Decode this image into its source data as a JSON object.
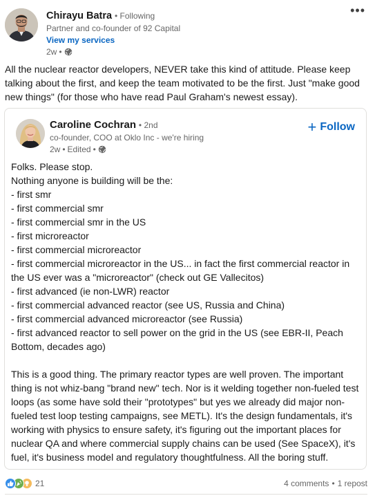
{
  "post": {
    "menu_icon": "ellipsis-icon",
    "author": {
      "name": "Chirayu Batra",
      "follow_status": "Following",
      "headline": "Partner and co-founder of 92 Capital",
      "services_link": "View my services",
      "time": "2w",
      "visibility_icon": "globe-icon"
    },
    "commentary": "All the nuclear reactor developers, NEVER take this kind of attitude. Please keep talking about the first, and keep the team motivated to be the first. Just \"make good new things\" (for those who have read Paul Graham's newest essay).",
    "shared": {
      "author": {
        "name": "Caroline Cochran",
        "degree": "2nd",
        "headline": "co-founder, COO at Oklo Inc - we're hiring",
        "time": "2w",
        "edited": "Edited",
        "visibility_icon": "globe-icon"
      },
      "follow_label": "Follow",
      "lines": [
        "Folks. Please stop.",
        "Nothing anyone is building will be the:",
        "- first smr",
        "- first commercial smr",
        "- first commercial smr in the US",
        "- first microreactor",
        "- first commercial microreactor",
        "- first commercial microreactor in the US... in fact the first commercial reactor in",
        "the US ever was a \"microreactor\" (check out GE Vallecitos)",
        "- first advanced (ie non-LWR) reactor",
        "- first commercial advanced reactor (see US, Russia and China)",
        "- first commercial advanced microreactor (see Russia)",
        "- first advanced reactor to sell power on the grid in the US (see EBR-II, Peach",
        "Bottom, decades ago)"
      ],
      "paragraph": "This is a good thing. The primary reactor types are well proven. The important thing is not whiz-bang \"brand new\" tech.  Nor is it welding together non-fueled test loops (as some have sold their \"prototypes\" but yes we already did major non-fueled test loop testing campaigns, see METL). It's the design fundamentals, it's working with physics to ensure safety, it's figuring out the important places for nuclear QA and where commercial supply chains can be used (See SpaceX), it's fuel, it's business model and regulatory thoughtfulness. All the boring stuff."
    },
    "social": {
      "reaction_icons": [
        "like-icon",
        "celebrate-icon",
        "insightful-icon"
      ],
      "reaction_count": "21",
      "comments": "4 comments",
      "dot": "•",
      "reposts": "1 repost"
    }
  },
  "colors": {
    "link_blue": "#0a66c2",
    "muted_text": "#666666",
    "border": "#e0dfdc",
    "like_blue": "#378fe9",
    "celebrate_green": "#6dae4f",
    "insight_yellow": "#f5bb5c"
  }
}
